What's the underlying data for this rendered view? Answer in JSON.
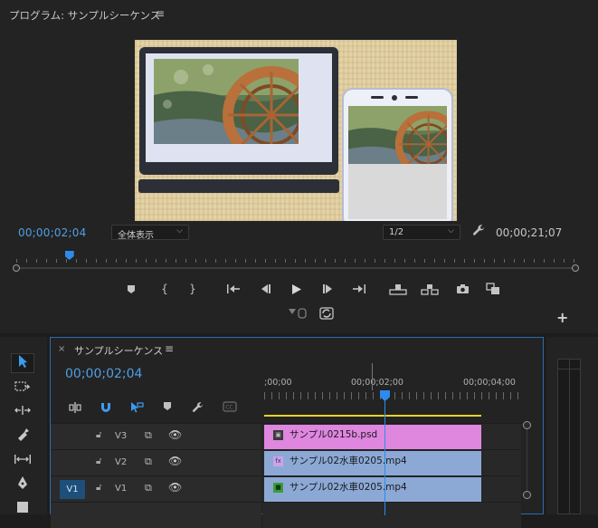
{
  "monitor": {
    "title": "プログラム: サンプルシーケンス",
    "menu_icon": "≡",
    "timecode_current": "00;00;02;04",
    "timecode_duration": "00;00;21;07",
    "zoom": {
      "selected": "全体表示"
    },
    "resolution": {
      "selected": "1/2"
    },
    "playhead_fraction": 0.095,
    "transport_icons": [
      "marker-icon",
      "mark-in-icon",
      "mark-out-icon",
      "go-to-in-icon",
      "step-back-icon",
      "play-icon",
      "step-forward-icon",
      "go-to-out-icon",
      "lift-icon",
      "extract-icon",
      "export-frame-icon",
      "comparison-view-icon"
    ],
    "secondary_icons": [
      "safe-margins-icon",
      "loop-icon",
      "add-button-icon"
    ]
  },
  "timeline": {
    "title": "サンプルシーケンス",
    "menu_icon": "≡",
    "close_label": "×",
    "timecode": "00;00;02;04",
    "ruler_labels": [
      ";00;00",
      "00;00;02;00",
      "00;00;04;00"
    ],
    "tools": [
      "snap-nest-icon",
      "magnet-icon",
      "linked-selection-icon",
      "add-marker-icon",
      "wrench-icon",
      "captions-icon"
    ],
    "tracks": [
      {
        "name": "V3",
        "source": "",
        "clip": "サンプル0215b.psd",
        "color": "#df86df",
        "badge": "fx"
      },
      {
        "name": "V2",
        "source": "",
        "clip": "サンプル02水車0205.mp4",
        "color": "#8ca9d6",
        "badge": "fx"
      },
      {
        "name": "V1",
        "source": "V1",
        "clip": "サンプル02水車0205.mp4",
        "color": "#8ca9d6",
        "badge": "fx"
      }
    ]
  },
  "tools_panel": [
    "selection-tool-icon",
    "track-select-tool-icon",
    "ripple-edit-tool-icon",
    "razor-tool-icon",
    "slip-tool-icon",
    "pen-tool-icon",
    "rectangle-tool-icon"
  ],
  "colors": {
    "accent_blue": "#2d8ceb",
    "timecode_blue": "#4e9fe3",
    "work_area": "#e8d22a"
  }
}
